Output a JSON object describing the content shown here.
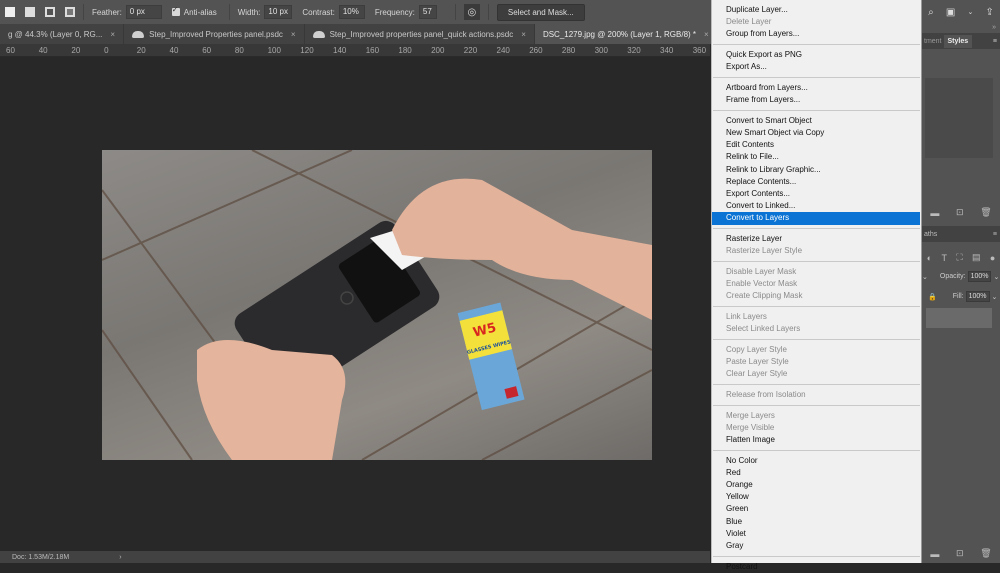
{
  "options_bar": {
    "feather_label": "Feather:",
    "feather_value": "0 px",
    "antialias_label": "Anti-alias",
    "antialias_checked": true,
    "width_label": "Width:",
    "width_value": "10 px",
    "contrast_label": "Contrast:",
    "contrast_value": "10%",
    "frequency_label": "Frequency:",
    "frequency_value": "57",
    "select_mask_label": "Select and Mask..."
  },
  "tabs": [
    {
      "label": "g @ 44.3% (Layer 0, RG...",
      "cloud": false,
      "active": false
    },
    {
      "label": "Step_Improved Properties panel.psdc",
      "cloud": true,
      "active": false
    },
    {
      "label": "Step_Improved properties panel_quick actions.psdc",
      "cloud": true,
      "active": false
    },
    {
      "label": "DSC_1279.jpg @ 200% (Layer 1, RGB/8) *",
      "cloud": false,
      "active": true
    }
  ],
  "ruler": [
    "60",
    "40",
    "20",
    "0",
    "20",
    "40",
    "60",
    "80",
    "100",
    "120",
    "140",
    "160",
    "180",
    "200",
    "220",
    "240",
    "260",
    "280",
    "300",
    "320",
    "340",
    "360"
  ],
  "photo": {
    "package_brand": "W5",
    "package_text": "GLASSES WIPES"
  },
  "status": {
    "doc": "Doc: 1.53M/2.18M",
    "arrow": "›"
  },
  "context_menu": {
    "groups": [
      [
        {
          "label": "Duplicate Layer...",
          "enabled": true
        },
        {
          "label": "Delete Layer",
          "enabled": false
        },
        {
          "label": "Group from Layers...",
          "enabled": true
        }
      ],
      [
        {
          "label": "Quick Export as PNG",
          "enabled": true
        },
        {
          "label": "Export As...",
          "enabled": true
        }
      ],
      [
        {
          "label": "Artboard from Layers...",
          "enabled": true
        },
        {
          "label": "Frame from Layers...",
          "enabled": true
        }
      ],
      [
        {
          "label": "Convert to Smart Object",
          "enabled": true
        },
        {
          "label": "New Smart Object via Copy",
          "enabled": true
        },
        {
          "label": "Edit Contents",
          "enabled": true
        },
        {
          "label": "Relink to File...",
          "enabled": true
        },
        {
          "label": "Relink to Library Graphic...",
          "enabled": true
        },
        {
          "label": "Replace Contents...",
          "enabled": true
        },
        {
          "label": "Export Contents...",
          "enabled": true
        },
        {
          "label": "Convert to Linked...",
          "enabled": true
        },
        {
          "label": "Convert to Layers",
          "enabled": true,
          "highlighted": true
        }
      ],
      [
        {
          "label": "Rasterize Layer",
          "enabled": true
        },
        {
          "label": "Rasterize Layer Style",
          "enabled": false
        }
      ],
      [
        {
          "label": "Disable Layer Mask",
          "enabled": false
        },
        {
          "label": "Enable Vector Mask",
          "enabled": false
        },
        {
          "label": "Create Clipping Mask",
          "enabled": false
        }
      ],
      [
        {
          "label": "Link Layers",
          "enabled": false
        },
        {
          "label": "Select Linked Layers",
          "enabled": false
        }
      ],
      [
        {
          "label": "Copy Layer Style",
          "enabled": false
        },
        {
          "label": "Paste Layer Style",
          "enabled": false
        },
        {
          "label": "Clear Layer Style",
          "enabled": false
        }
      ],
      [
        {
          "label": "Release from Isolation",
          "enabled": false
        }
      ],
      [
        {
          "label": "Merge Layers",
          "enabled": false
        },
        {
          "label": "Merge Visible",
          "enabled": false
        },
        {
          "label": "Flatten Image",
          "enabled": true
        }
      ],
      [
        {
          "label": "No Color",
          "enabled": true
        },
        {
          "label": "Red",
          "enabled": true
        },
        {
          "label": "Orange",
          "enabled": true
        },
        {
          "label": "Yellow",
          "enabled": true
        },
        {
          "label": "Green",
          "enabled": true
        },
        {
          "label": "Blue",
          "enabled": true
        },
        {
          "label": "Violet",
          "enabled": true
        },
        {
          "label": "Gray",
          "enabled": true
        }
      ],
      [
        {
          "label": "Postcard",
          "enabled": true
        }
      ]
    ]
  },
  "right_panel": {
    "tab_adjustments": "tment",
    "tab_styles": "Styles",
    "tab_paths": "aths",
    "opacity_label": "Opacity:",
    "opacity_value": "100%",
    "fill_label": "Fill:",
    "fill_value": "100%",
    "collapse": "»"
  },
  "colors": {
    "highlight": "#0a73d4",
    "menu_bg": "#f0f0f0",
    "panel_bg": "#535353",
    "canvas_bg": "#282828"
  }
}
